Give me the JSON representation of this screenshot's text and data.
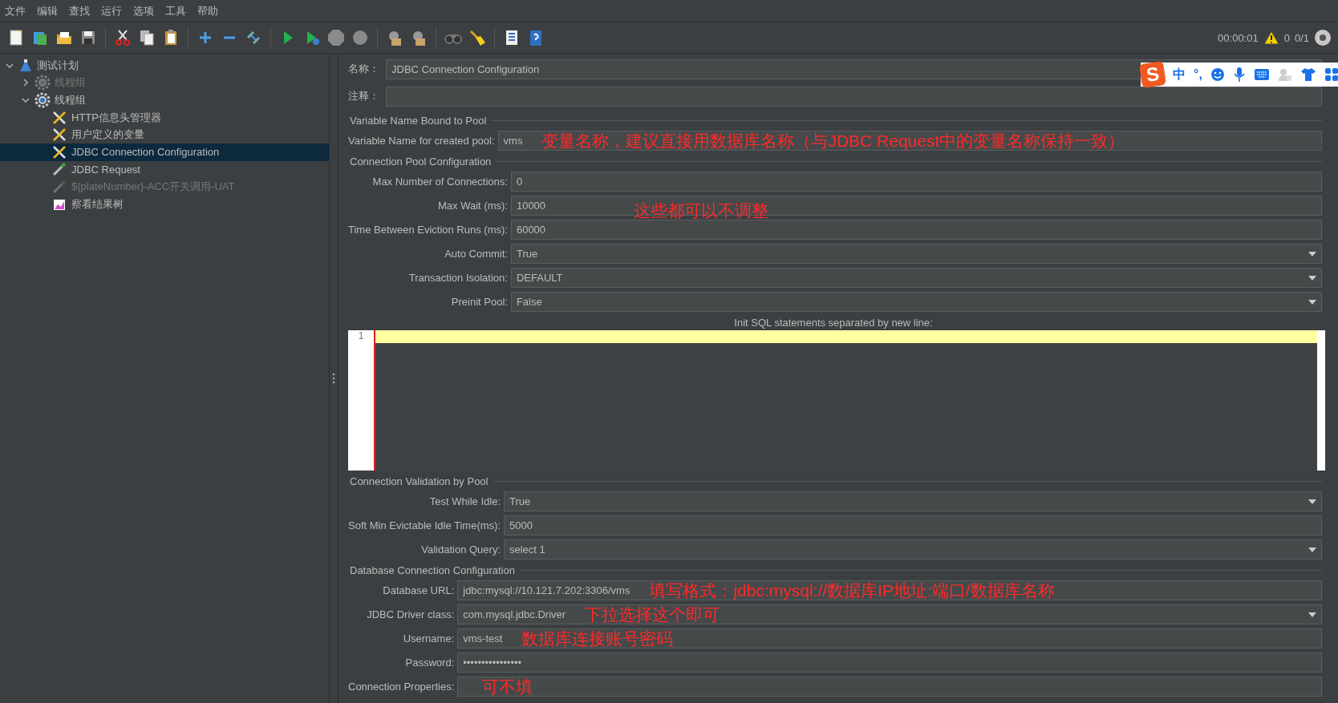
{
  "menu": [
    "文件",
    "编辑",
    "查找",
    "运行",
    "选项",
    "工具",
    "帮助"
  ],
  "status": {
    "elapsed": "00:00:01",
    "warnings": "0",
    "threads": "0/1"
  },
  "ime": {
    "logo": "S",
    "mode": "中",
    "punct": "°,"
  },
  "tree": [
    {
      "label": "测试计划",
      "expanded": true,
      "disabled": false,
      "selected": false,
      "children": [
        {
          "label": "线程组",
          "expanded": false,
          "disabled": true,
          "selected": false
        },
        {
          "label": "线程组",
          "expanded": true,
          "disabled": false,
          "selected": false,
          "children": [
            {
              "label": "HTTP信息头管理器",
              "kind": "config",
              "disabled": false,
              "selected": false
            },
            {
              "label": "用户定义的变量",
              "kind": "config",
              "disabled": false,
              "selected": false
            },
            {
              "label": "JDBC Connection Configuration",
              "kind": "config",
              "disabled": false,
              "selected": true
            },
            {
              "label": "JDBC Request",
              "kind": "sampler",
              "disabled": false,
              "selected": false
            },
            {
              "label": "${plateNumber}-ACC开关调用-UAT",
              "kind": "sampler",
              "disabled": true,
              "selected": false
            },
            {
              "label": "察看结果树",
              "kind": "listener",
              "disabled": false,
              "selected": false
            }
          ]
        }
      ]
    }
  ],
  "name": {
    "label": "名称：",
    "value": "JDBC Connection Configuration"
  },
  "comment": {
    "label": "注释："
  },
  "sections": [
    {
      "title": "Variable Name Bound to Pool",
      "rows": [
        {
          "label": "Variable Name for created pool:",
          "kind": "text",
          "value": "vms",
          "note": "变量名称，建议直接用数据库名称（与JDBC Request中的变量名称保持一致）"
        }
      ]
    },
    {
      "title": "Connection Pool Configuration",
      "rows": [
        {
          "label": "Max Number of Connections:",
          "kind": "text",
          "value": "0"
        },
        {
          "label": "Max Wait (ms):",
          "kind": "text",
          "value": "10000",
          "note": "这些都可以不调整"
        },
        {
          "label": "Time Between Eviction Runs (ms):",
          "kind": "text",
          "value": "60000"
        },
        {
          "label": "Auto Commit:",
          "kind": "select",
          "value": "True"
        },
        {
          "label": "Transaction Isolation:",
          "kind": "select",
          "value": "DEFAULT"
        },
        {
          "label": "Preinit Pool:",
          "kind": "select",
          "value": "False"
        }
      ],
      "editor": {
        "caption": "Init SQL statements separated by new line:",
        "line": "1"
      }
    },
    {
      "title": "Connection Validation by Pool",
      "rows": [
        {
          "label": "Test While Idle:",
          "kind": "select",
          "value": "True"
        },
        {
          "label": "Soft Min Evictable Idle Time(ms):",
          "kind": "text",
          "value": "5000"
        },
        {
          "label": "Validation Query:",
          "kind": "select",
          "value": "select 1"
        }
      ]
    },
    {
      "title": "Database Connection Configuration",
      "rows": [
        {
          "label": "Database URL:",
          "kind": "text",
          "value": "jdbc:mysql://10.121.7.202:3306/vms",
          "note": "填写格式：jdbc:mysql://数据库IP地址:端口/数据库名称"
        },
        {
          "label": "JDBC Driver class:",
          "kind": "select",
          "value": "com.mysql.jdbc.Driver",
          "note": "下拉选择这个即可"
        },
        {
          "label": "Username:",
          "kind": "text",
          "value": "vms-test",
          "note": "数据库连接账号密码"
        },
        {
          "label": "Password:",
          "kind": "password",
          "value": "••••••••••••••••"
        },
        {
          "label": "Connection Properties:",
          "kind": "text",
          "note": "可不填"
        }
      ]
    }
  ]
}
